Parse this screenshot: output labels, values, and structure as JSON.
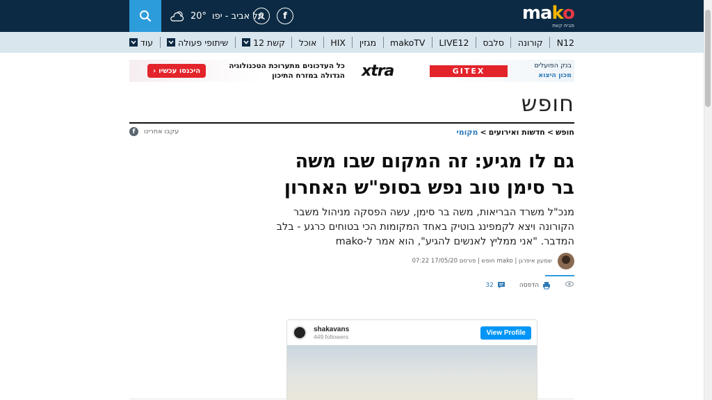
{
  "header": {
    "logo_text": "mako",
    "logo_tagline": "מבית קשת",
    "weather_city": "תל אביב - יפו",
    "weather_temp": "20°",
    "icons": [
      "search-icon",
      "weather-icon",
      "user-icon",
      "facebook-icon"
    ]
  },
  "nav": {
    "items": [
      {
        "label": "N12"
      },
      {
        "label": "קורונה"
      },
      {
        "label": "סלבס"
      },
      {
        "label": "LIVE12"
      },
      {
        "label": "makoTV"
      },
      {
        "label": "מגזין"
      },
      {
        "label": "HIX"
      },
      {
        "label": "אוכל"
      },
      {
        "label": "קשת 12",
        "dropdown": true
      },
      {
        "label": "שיתופי פעולה",
        "dropdown": true
      },
      {
        "label": "עוד",
        "dropdown": true
      }
    ]
  },
  "ad": {
    "bank_line1": "בנק הפועלים",
    "bank_line2": "מכון היצוא",
    "gitex": "GITEX",
    "xtra": "xtra",
    "text_line1": "כל העדכונים מתערוכת הטכנולוגיה",
    "text_line2": "הגדולה במזרח התיכון",
    "cta": "היכנסו עכשיו"
  },
  "section": {
    "title": "חופש"
  },
  "breadcrumb": {
    "items": [
      "חופש",
      "חדשות ואירועים",
      "מקומי"
    ],
    "separator": ">"
  },
  "follow": {
    "label": "עקבו אחרינו"
  },
  "article": {
    "headline": "גם לו מגיע: זה המקום שבו משה בר סימן טוב נפש בסופ\"ש האחרון",
    "lead": "מנכ\"ל משרד הבריאות, משה בר סימן, עשה הפסקה מניהול משבר הקורונה ויצא לקמפינג בוטיק באחד המקומות הכי בטוחים כרגע - בלב המדבר. \"אני ממליץ לאנשים להגיע\", הוא אמר ל-mako",
    "byline": "שמעון איפרגן | mako חופש | פורסם 17/05/20 07:22"
  },
  "actions": {
    "print_label": "הדפסה",
    "comments_count": "32"
  },
  "embed": {
    "username": "shakavans",
    "followers": "449 followers",
    "button": "View Profile"
  },
  "colors": {
    "topbar": "#0c2a43",
    "accent": "#2d9cdb",
    "nav_bg": "#d9e6ee",
    "ad_red": "#e3242b"
  }
}
